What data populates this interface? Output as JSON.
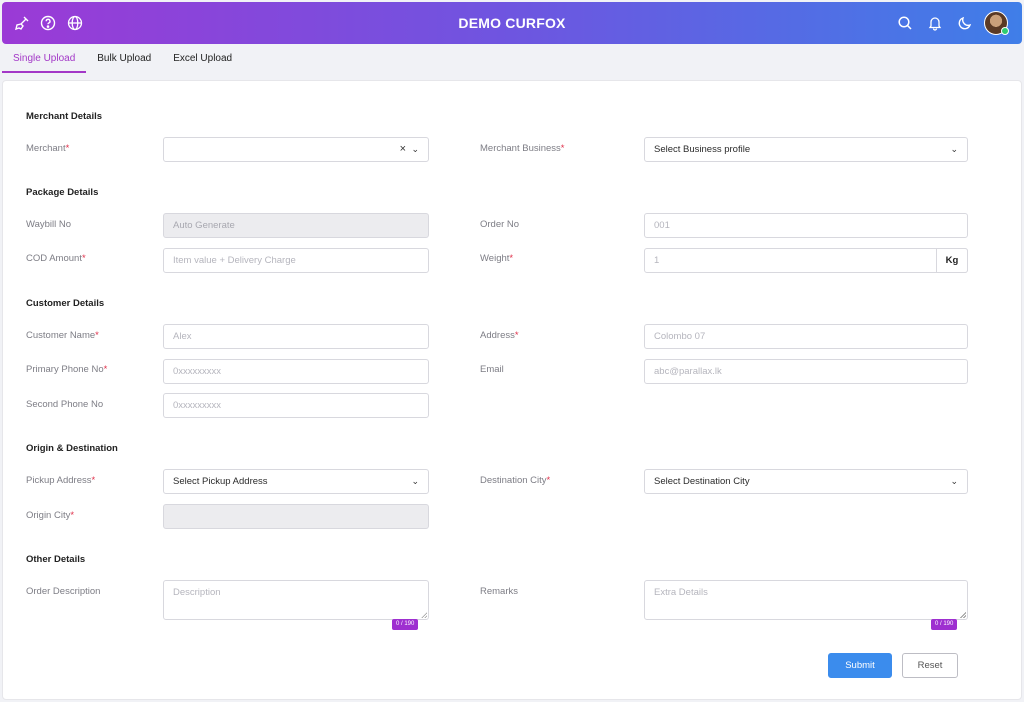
{
  "header": {
    "title": "DEMO CURFOX"
  },
  "tabs": [
    "Single Upload",
    "Bulk Upload",
    "Excel Upload"
  ],
  "sections": {
    "merchant": "Merchant Details",
    "package": "Package Details",
    "customer": "Customer Details",
    "origin": "Origin & Destination",
    "other": "Other Details"
  },
  "labels": {
    "merchant": "Merchant",
    "merchant_business": "Merchant Business",
    "waybill": "Waybill No",
    "order_no": "Order No",
    "cod": "COD Amount",
    "weight": "Weight",
    "customer_name": "Customer Name",
    "address": "Address",
    "primary_phone": "Primary Phone No",
    "email": "Email",
    "second_phone": "Second Phone No",
    "pickup_address": "Pickup Address",
    "destination_city": "Destination City",
    "origin_city": "Origin City",
    "order_description": "Order Description",
    "remarks": "Remarks"
  },
  "required_mark": "*",
  "fields": {
    "merchant_business": "Select Business profile",
    "waybill_placeholder": "Auto Generate",
    "order_no_placeholder": "001",
    "cod_placeholder": "Item value + Delivery Charge",
    "weight_placeholder": "1",
    "weight_unit": "Kg",
    "customer_name_placeholder": "Alex",
    "address_placeholder": "Colombo 07",
    "primary_phone_placeholder": "0xxxxxxxxx",
    "email_placeholder": "abc@parallax.lk",
    "second_phone_placeholder": "0xxxxxxxxx",
    "pickup_address": "Select Pickup Address",
    "destination_city": "Select Destination City",
    "description_placeholder": "Description",
    "remarks_placeholder": "Extra Details",
    "description_counter": "0 / 190",
    "remarks_counter": "0 / 190"
  },
  "buttons": {
    "submit": "Submit",
    "reset": "Reset"
  },
  "icons": [
    "broom-icon",
    "help-icon",
    "globe-icon",
    "search-icon",
    "bell-icon",
    "moon-icon",
    "avatar"
  ]
}
